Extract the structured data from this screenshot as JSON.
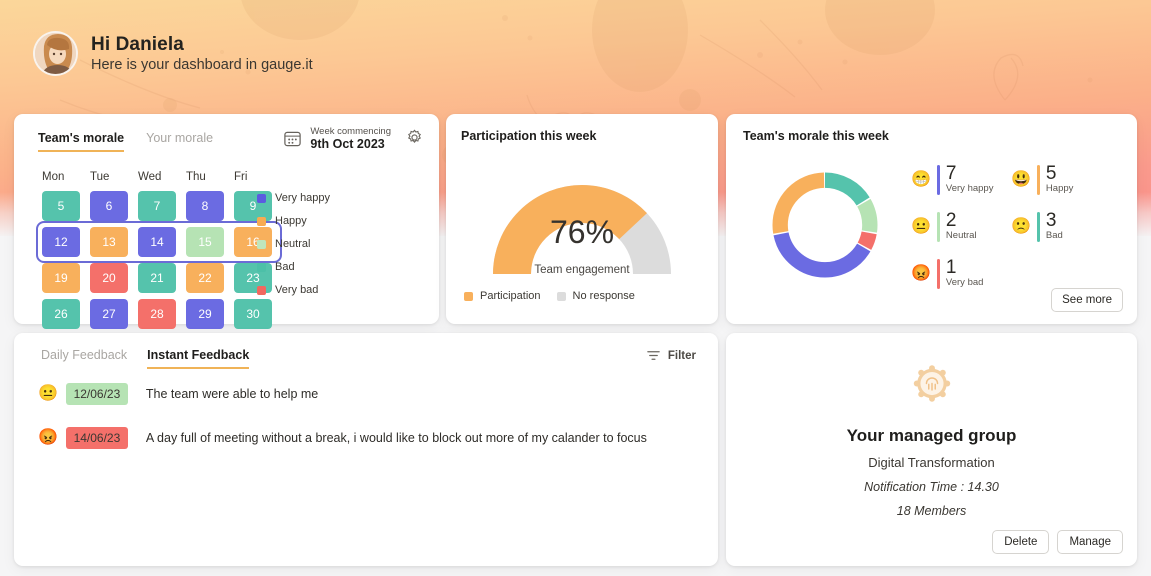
{
  "header": {
    "greeting": "Hi Daniela",
    "subtitle": "Here is your dashboard in gauge.it",
    "avatar_icon": "user-avatar"
  },
  "calendar_card": {
    "tabs": [
      {
        "label": "Team's morale",
        "active": true
      },
      {
        "label": "Your morale",
        "active": false
      }
    ],
    "week_label": "Week commencing",
    "week_value": "9th Oct 2023",
    "calendar_icon": "calendar-icon",
    "settings_icon": "gear-icon",
    "day_names": [
      "Mon",
      "Tue",
      "Wed",
      "Thu",
      "Fri"
    ],
    "weeks": [
      {
        "selected": false,
        "days": [
          {
            "n": "5",
            "mood": "bad"
          },
          {
            "n": "6",
            "mood": "very_happy"
          },
          {
            "n": "7",
            "mood": "bad"
          },
          {
            "n": "8",
            "mood": "very_happy"
          },
          {
            "n": "9",
            "mood": "bad"
          }
        ]
      },
      {
        "selected": true,
        "days": [
          {
            "n": "12",
            "mood": "very_happy"
          },
          {
            "n": "13",
            "mood": "happy"
          },
          {
            "n": "14",
            "mood": "very_happy"
          },
          {
            "n": "15",
            "mood": "neutral"
          },
          {
            "n": "16",
            "mood": "happy"
          }
        ]
      },
      {
        "selected": false,
        "days": [
          {
            "n": "19",
            "mood": "happy"
          },
          {
            "n": "20",
            "mood": "very_bad"
          },
          {
            "n": "21",
            "mood": "bad"
          },
          {
            "n": "22",
            "mood": "happy"
          },
          {
            "n": "23",
            "mood": "bad"
          }
        ]
      },
      {
        "selected": false,
        "days": [
          {
            "n": "26",
            "mood": "bad"
          },
          {
            "n": "27",
            "mood": "very_happy"
          },
          {
            "n": "28",
            "mood": "very_bad"
          },
          {
            "n": "29",
            "mood": "very_happy"
          },
          {
            "n": "30",
            "mood": "bad"
          }
        ]
      }
    ],
    "legend": [
      {
        "label": "Very happy",
        "color": "#5b5be0"
      },
      {
        "label": "Happy",
        "color": "#f7ab52"
      },
      {
        "label": "Neutral",
        "color": "#bfe6bd"
      },
      {
        "label": "Bad",
        "color": "#4cc0a8"
      },
      {
        "label": "Very bad",
        "color": "#f2685f"
      }
    ],
    "mood_colors": {
      "very_happy": "#6b6be2",
      "happy": "#f8b05c",
      "neutral": "#b6e3b4",
      "bad": "#55c3ac",
      "very_bad": "#f4706a"
    },
    "selection_color": "#6b6bd6"
  },
  "gauge_card": {
    "title": "Participation this week",
    "caption": "Team engagement",
    "legend": [
      {
        "label": "Participation",
        "color": "#f8b05c"
      },
      {
        "label": "No response",
        "color": "#dcdcdc"
      }
    ]
  },
  "morale_card": {
    "title": "Team's morale this week",
    "see_more": "See more",
    "items": [
      {
        "emoji": "😁",
        "count": "7",
        "label": "Very happy",
        "color": "#6b6be2"
      },
      {
        "emoji": "😃",
        "count": "5",
        "label": "Happy",
        "color": "#f8b05c"
      },
      {
        "emoji": "😐",
        "count": "2",
        "label": "Neutral",
        "color": "#b6e3b4"
      },
      {
        "emoji": "🙁",
        "count": "3",
        "label": "Bad",
        "color": "#55c3ac"
      },
      {
        "emoji": "😡",
        "count": "1",
        "label": "Very bad",
        "color": "#f4706a"
      }
    ]
  },
  "feedback_card": {
    "tabs": [
      {
        "label": "Daily Feedback",
        "active": false
      },
      {
        "label": "Instant Feedback",
        "active": true
      }
    ],
    "filter_label": "Filter",
    "filter_icon": "filter-icon",
    "rows": [
      {
        "emoji": "😐",
        "date": "12/06/23",
        "date_bg": "#b6e3b4",
        "text": "The team were able to help me"
      },
      {
        "emoji": "😡",
        "date": "14/06/23",
        "date_bg": "#f4706a",
        "text": "A day full of meeting without a break, i would like to block out more of my calander to focus"
      }
    ]
  },
  "group_card": {
    "logo_icon": "gauge-badge-icon",
    "title": "Your managed group",
    "group_name": "Digital Transformation",
    "notification": "Notification Time : 14.30",
    "members": "18 Members",
    "delete_label": "Delete",
    "manage_label": "Manage"
  },
  "chart_data": [
    {
      "type": "pie",
      "title": "Participation this week",
      "subtitle": "Team engagement",
      "value_label": "76%",
      "categories": [
        "Participation",
        "No response"
      ],
      "values": [
        76,
        24
      ],
      "colors": [
        "#f8b05c",
        "#dcdcdc"
      ],
      "shape": "semicircle-gauge",
      "legend": "bottom"
    },
    {
      "type": "pie",
      "title": "Team's morale this week",
      "categories": [
        "Bad",
        "Neutral",
        "Very bad",
        "Very happy",
        "Happy"
      ],
      "values": [
        3,
        2,
        1,
        7,
        5
      ],
      "colors": [
        "#55c3ac",
        "#b6e3b4",
        "#f4706a",
        "#6b6be2",
        "#f8b05c"
      ],
      "shape": "donut",
      "total": 18,
      "legend": "right"
    }
  ]
}
